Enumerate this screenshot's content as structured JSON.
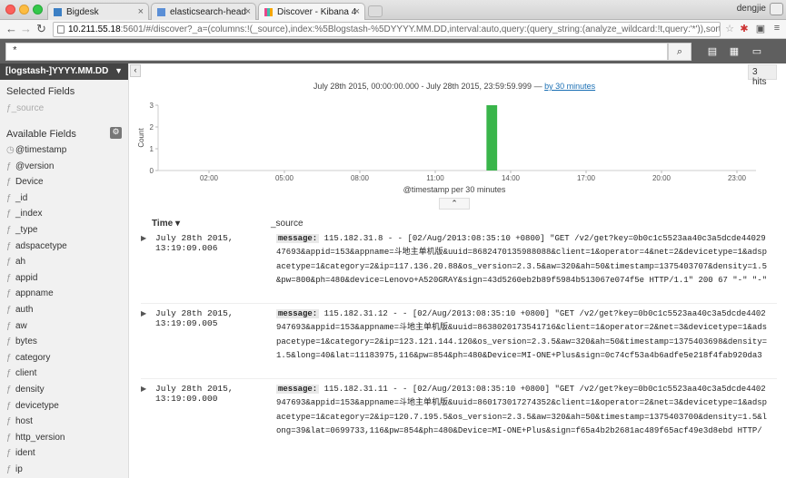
{
  "browser": {
    "tabs": [
      {
        "label": "Bigdesk",
        "active": false
      },
      {
        "label": "elasticsearch-head",
        "active": false
      },
      {
        "label": "Discover - Kibana 4",
        "active": true
      }
    ],
    "profile": "dengjie",
    "url_host": "10.211.55.18",
    "url_rest": ":5601/#/discover?_a=(columns:!(_source),index:%5Blogstash-%5DYYYY.MM.DD,interval:auto,query:(query_string:(analyze_wildcard:!t,query:'*')),sort:!('@timesta..."
  },
  "query": {
    "value": "*"
  },
  "sidebar": {
    "index_pattern": "[logstash-]YYYY.MM.DD",
    "selected_title": "Selected Fields",
    "selected_source": "_source",
    "available_title": "Available Fields",
    "fields": [
      {
        "type": "clock",
        "name": "@timestamp"
      },
      {
        "type": "t",
        "name": "@version"
      },
      {
        "type": "t",
        "name": "Device"
      },
      {
        "type": "t",
        "name": "_id"
      },
      {
        "type": "t",
        "name": "_index"
      },
      {
        "type": "t",
        "name": "_type"
      },
      {
        "type": "t",
        "name": "adspacetype"
      },
      {
        "type": "t",
        "name": "ah"
      },
      {
        "type": "t",
        "name": "appid"
      },
      {
        "type": "t",
        "name": "appname"
      },
      {
        "type": "t",
        "name": "auth"
      },
      {
        "type": "t",
        "name": "aw"
      },
      {
        "type": "t",
        "name": "bytes"
      },
      {
        "type": "t",
        "name": "category"
      },
      {
        "type": "t",
        "name": "client"
      },
      {
        "type": "t",
        "name": "density"
      },
      {
        "type": "t",
        "name": "devicetype"
      },
      {
        "type": "t",
        "name": "host"
      },
      {
        "type": "t",
        "name": "http_version"
      },
      {
        "type": "t",
        "name": "ident"
      },
      {
        "type": "t",
        "name": "ip"
      },
      {
        "type": "t",
        "name": "key"
      }
    ]
  },
  "main": {
    "hits": "3 hits",
    "range_text": "July 28th 2015, 00:00:00.000 - July 28th 2015, 23:59:59.999 —",
    "interval_link": "by 30 minutes",
    "time_col": "Time",
    "source_col": "_source",
    "rows": [
      {
        "time": "July 28th 2015, 13:19:09.006",
        "k1": "message:",
        "v1": "115.182.31.8 - - [02/Aug/2013:08:35:10 +0800] \"GET /v2/get?key=0b0c1c5523aa40c3a5dcde4402947693&appid=153&appname=斗地主单机版&uuid=8682470135988088&client=1&operator=4&net=2&devicetype=1&adspacetype=1&category=2&ip=117.136.20.88&os_version=2.3.5&aw=320&ah=50&timestamp=1375403707&density=1.5&pw=800&ph=480&device=Lenovo+A520GRAY&sign=43d5260eb2b89f5984b513067e074f5e HTTP/1.1\" 200 67 \"-\" \"-\"",
        "k2": "@version:",
        "v2": "1",
        "k3": "@timestamp:",
        "v3": "July 28th 2015, 13:19:09.006",
        "k4": "host:",
        "v4": "dn1",
        "k5": "path:",
        "v5": "/home/hadoop/dir/portal/t_customer_access.log",
        "tail": "type: type_count  client: 1  ident: -  auth: -  timestamp: 1375403707  verb: GET  request: /v"
      },
      {
        "time": "July 28th 2015, 13:19:09.005",
        "k1": "message:",
        "v1": "115.182.31.12 - - [02/Aug/2013:08:35:10 +0800] \"GET /v2/get?key=0b0c1c5523aa40c3a5dcde4402947693&appid=153&appname=斗地主单机版&uuid=8638020173541716&client=1&operator=2&net=3&devicetype=1&adspacetype=1&category=2&ip=123.121.144.120&os_version=2.3.5&aw=320&ah=50&timestamp=1375403698&density=1.5&long=40&lat=11183975,116&pw=854&ph=480&Device=MI-ONE+Plus&sign=0c74cf53a4b6adfe5e218f4fab920da3 HTTP/1.1\" 200 76 \"-\" \"-\"",
        "k2": "@version:",
        "v2": "1",
        "k3": "@timestamp:",
        "v3": "July 28th 2015, 13:19:09.005",
        "k4": "host:",
        "v4": "dn1",
        "k5": "path:",
        "v5": "/home/hadoop/dir/portal/t_customer_access.log",
        "tail": "type: type_count  client: 1  ident: -  auth: -  timestamp: 1375403698"
      },
      {
        "time": "July 28th 2015, 13:19:09.000",
        "k1": "message:",
        "v1": "115.182.31.11 - - [02/Aug/2013:08:35:10 +0800] \"GET /v2/get?key=0b0c1c5523aa40c3a5dcde4402947693&appid=153&appname=斗地主单机版&uuid=860173017274352&client=1&operator=2&net=3&devicetype=1&adspacetype=1&category=2&ip=120.7.195.5&os_version=2.3.5&aw=320&ah=50&timestamp=1375403700&density=1.5&long=39&lat=0699733,116&pw=854&ph=480&Device=MI-ONE+Plus&sign=f65a4b2b2681ac489f65acf49e3d8ebd HTTP/1.1\" 200 76 \"-\" \"-\"",
        "k2": "@version:",
        "v2": "1",
        "k3": "@timestamp:",
        "v3": "July 28th 2015, 13:19:09.000",
        "k4": "host:",
        "v4": "dn1",
        "k5": "path:",
        "v5": "/home/hadoop/dir/portal/t_customer_access.log",
        "tail": "type: type_count  client: 1  ident: -  auth: -  timestamp: 1375403700"
      }
    ]
  },
  "chart_data": {
    "type": "bar",
    "xlabel": "@timestamp per 30 minutes",
    "ylabel": "Count",
    "x_ticks": [
      "02:00",
      "05:00",
      "08:00",
      "11:00",
      "14:00",
      "17:00",
      "20:00",
      "23:00"
    ],
    "y_ticks": [
      0,
      1,
      2,
      3
    ],
    "ylim": [
      0,
      3
    ],
    "bars": [
      {
        "x": "13:00",
        "value": 3
      }
    ],
    "bar_color": "#39b54a"
  }
}
